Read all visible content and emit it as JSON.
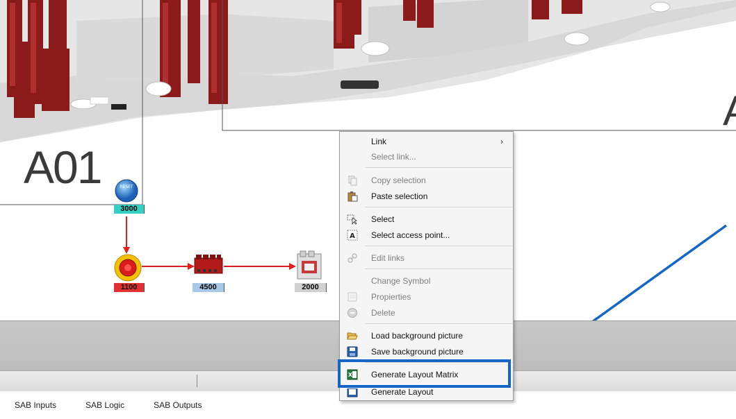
{
  "canvas": {
    "rack_labels": [
      "A01",
      "A"
    ],
    "symbols": [
      {
        "name": "reset-button-symbol",
        "tag": "3000",
        "tag_color": "#33d1c4"
      },
      {
        "name": "emergency-stop-symbol",
        "tag": "1100",
        "tag_color": "#e03030"
      },
      {
        "name": "safety-relay-symbol",
        "tag": "4500",
        "tag_color": "#a8c8e8"
      },
      {
        "name": "contactor-symbol",
        "tag": "2000",
        "tag_color": "#d0d0d0"
      }
    ],
    "link_color": "#e02020",
    "reset_symbol_text": "RESET"
  },
  "context_menu": {
    "items": [
      {
        "label": "Link",
        "enabled": true,
        "submenu": true,
        "icon": ""
      },
      {
        "label": "Select link...",
        "enabled": false,
        "icon": ""
      },
      {
        "label": "Copy selection",
        "enabled": false,
        "icon": "copy-icon"
      },
      {
        "label": "Paste selection",
        "enabled": true,
        "icon": "paste-icon"
      },
      {
        "label": "Select",
        "enabled": true,
        "icon": "select-pointer-icon"
      },
      {
        "label": "Select access point...",
        "enabled": true,
        "icon": "access-point-icon"
      },
      {
        "label": "Edit links",
        "enabled": false,
        "icon": "edit-links-icon"
      },
      {
        "label": "Change Symbol",
        "enabled": false,
        "icon": ""
      },
      {
        "label": "Propierties",
        "enabled": false,
        "icon": "properties-icon"
      },
      {
        "label": "Delete",
        "enabled": false,
        "icon": "delete-icon"
      },
      {
        "label": "Load background picture",
        "enabled": true,
        "icon": "folder-open-icon"
      },
      {
        "label": "Save background picture",
        "enabled": true,
        "icon": "save-icon"
      },
      {
        "label": "Generate Layout Matrix",
        "enabled": true,
        "icon": "excel-icon",
        "highlighted": true
      },
      {
        "label": "Generate Layout",
        "enabled": true,
        "icon": "layout-icon"
      }
    ],
    "submenu_arrow": "›",
    "highlight_color": "#1565c8"
  },
  "tabs": [
    "SAB Inputs",
    "SAB Logic",
    "SAB Outputs"
  ]
}
